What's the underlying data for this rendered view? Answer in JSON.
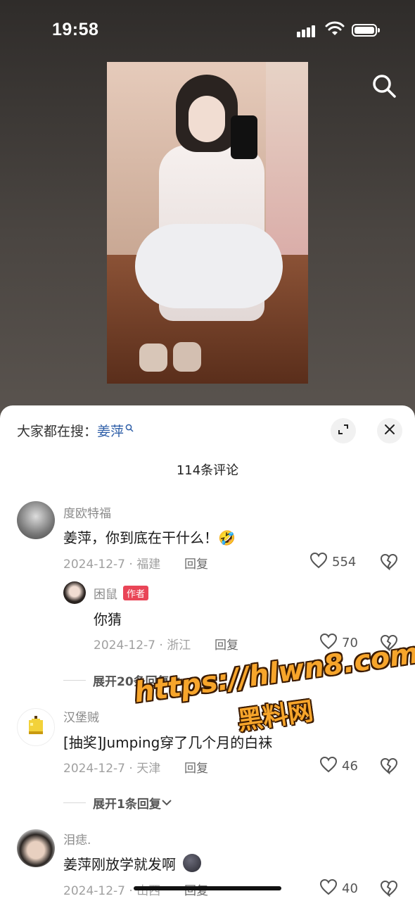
{
  "status_bar": {
    "time": "19:58"
  },
  "sheet": {
    "search_prefix": "大家都在搜：",
    "search_keyword": "姜萍",
    "comment_count": "114条评论"
  },
  "comments": [
    {
      "username": "度欧特福",
      "text": "姜萍，你到底在干什么！🤣",
      "date_location": "2024-12-7 · 福建",
      "reply_label": "回复",
      "likes": "554"
    },
    {
      "username": "困鼠",
      "author_badge": "作者",
      "text": "你猜",
      "date_location": "2024-12-7 · 浙江",
      "reply_label": "回复",
      "likes": "70"
    },
    {
      "username": "汉堡贼",
      "text": "[抽奖]Jumping穿了几个月的白袜",
      "date_location": "2024-12-7 · 天津",
      "reply_label": "回复",
      "likes": "46"
    },
    {
      "username": "泪痣.",
      "text": "姜萍刚放学就发啊",
      "date_location": "2024-12-7 · 山西",
      "reply_label": "回复",
      "likes": "40"
    }
  ],
  "expand_replies": [
    "展开20条回复",
    "展开1条回复"
  ],
  "watermark": {
    "line1": "https://hlwn8.com",
    "line2": "黑料网"
  },
  "icons": [
    "search-icon",
    "expand-icon",
    "close-icon",
    "heart-icon",
    "broken-heart-icon",
    "chevron-down-icon"
  ]
}
